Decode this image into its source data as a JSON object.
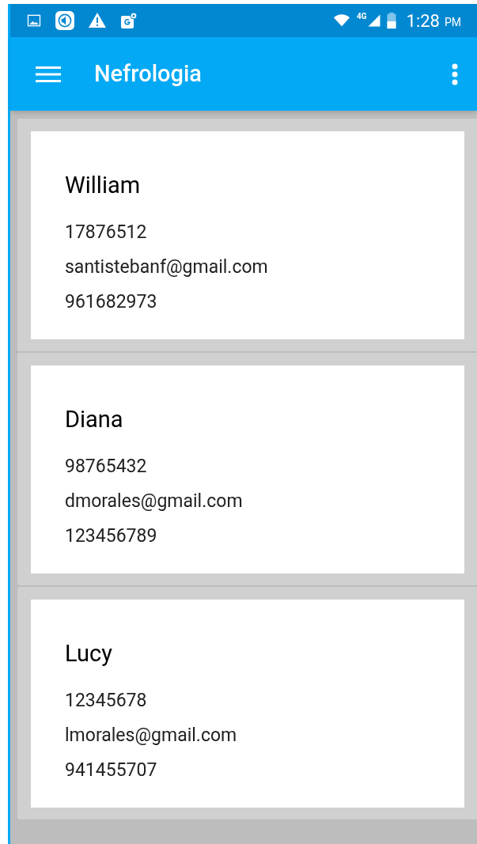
{
  "status_bar": {
    "network": "4G",
    "time": "1:28",
    "meridiem": "PM"
  },
  "app_bar": {
    "title": "Nefrologia"
  },
  "contacts": [
    {
      "name": "William",
      "id_number": "17876512",
      "email": "santistebanf@gmail.com",
      "phone": "961682973"
    },
    {
      "name": "Diana",
      "id_number": "98765432",
      "email": "dmorales@gmail.com",
      "phone": "123456789"
    },
    {
      "name": "Lucy",
      "id_number": "12345678",
      "email": "lmorales@gmail.com",
      "phone": "941455707"
    }
  ]
}
